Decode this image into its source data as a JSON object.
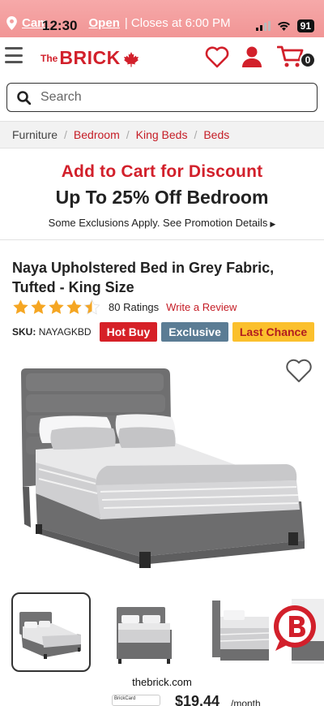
{
  "status_bar": {
    "store_prefix": "Cam",
    "store_suffix": "Open",
    "time": "12:30",
    "closes": "| Closes at 6:00 PM",
    "battery": "91"
  },
  "header": {
    "logo_the": "The",
    "logo_brick": "BRICK",
    "cart_count": "0"
  },
  "search": {
    "placeholder": "Search"
  },
  "breadcrumb": {
    "items": [
      "Furniture",
      "Bedroom",
      "King Beds",
      "Beds"
    ],
    "separator": "/"
  },
  "promo": {
    "line1": "Add to Cart for Discount",
    "line2": "Up To 25% Off Bedroom",
    "line3": "Some Exclusions Apply. See Promotion Details"
  },
  "product": {
    "title": "Naya Upholstered Bed in Grey Fabric, Tufted - King Size",
    "rating": 4.5,
    "ratings_count": "80 Ratings",
    "review_link": "Write a Review",
    "sku_label": "SKU:",
    "sku_value": "NAYAGKBD",
    "badges": [
      "Hot Buy",
      "Exclusive",
      "Last Chance"
    ]
  },
  "footer": {
    "url": "thebrick.com",
    "price": "$19.44",
    "per": "/month",
    "card_label": "BrickCard"
  },
  "colors": {
    "brand_red": "#d2202b",
    "hot_buy": "#d62027",
    "exclusive": "#5b7c94",
    "last_chance": "#fbc02d",
    "star": "#f5a623"
  }
}
